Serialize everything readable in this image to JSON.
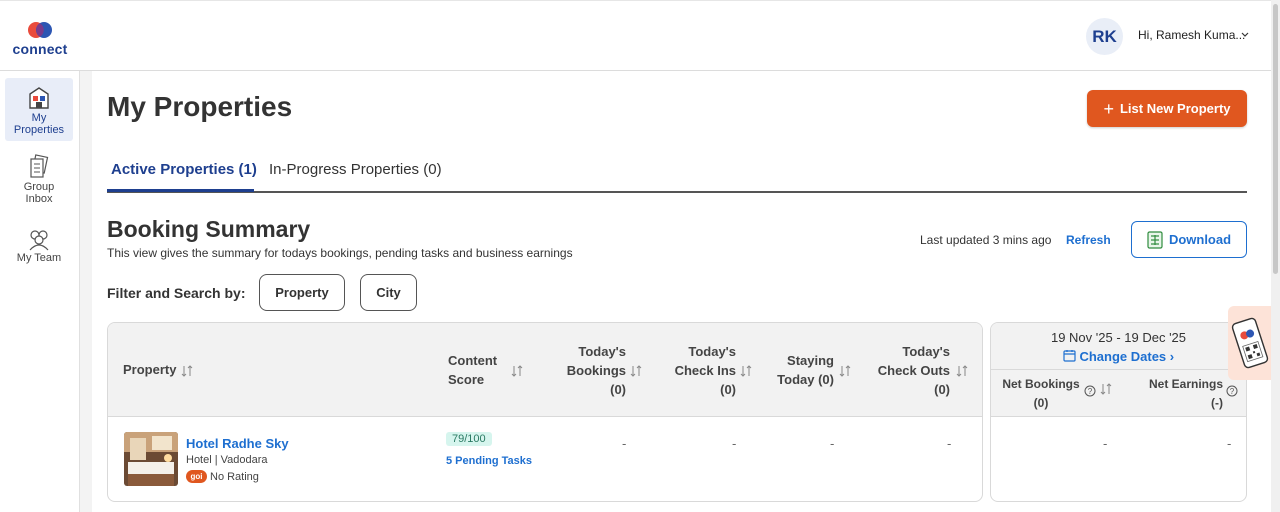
{
  "header": {
    "logo_text": "connect",
    "avatar_initials": "RK",
    "greeting": "Hi, Ramesh Kuma..."
  },
  "sidebar": {
    "items": [
      {
        "label_line1": "My",
        "label_line2": "Properties",
        "icon": "properties-icon",
        "active": true
      },
      {
        "label_line1": "Group",
        "label_line2": "Inbox",
        "icon": "group-inbox-icon",
        "active": false
      },
      {
        "label_line1": "My Team",
        "label_line2": "",
        "icon": "team-icon",
        "active": false
      }
    ]
  },
  "page": {
    "title": "My Properties",
    "primary_button": "List New Property"
  },
  "tabs": [
    {
      "label": "Active Properties (1)",
      "active": true
    },
    {
      "label": "In-Progress Properties (0)",
      "active": false
    }
  ],
  "summary": {
    "title": "Booking Summary",
    "subtitle": "This view gives the summary for todays bookings, pending tasks and business earnings",
    "last_updated": "Last updated 3 mins ago",
    "refresh": "Refresh",
    "download": "Download"
  },
  "filter": {
    "label": "Filter and Search by:",
    "chips": [
      "Property",
      "City"
    ]
  },
  "table": {
    "headers": {
      "property": "Property",
      "content_score_l1": "Content",
      "content_score_l2": "Score",
      "bookings_l1": "Today's",
      "bookings_l2": "Bookings",
      "bookings_l3": "(0)",
      "checkins_l1": "Today's",
      "checkins_l2": "Check Ins",
      "checkins_l3": "(0)",
      "staying_l1": "Staying",
      "staying_l2": "Today (0)",
      "checkouts_l1": "Today's",
      "checkouts_l2": "Check Outs",
      "checkouts_l3": "(0)"
    },
    "rows": [
      {
        "name": "Hotel Radhe Sky",
        "type_city": "Hotel | Vadodara",
        "rating_badge": "goibibo",
        "rating": "No Rating",
        "score": "79/100",
        "pending": "5 Pending Tasks",
        "bookings": "-",
        "checkins": "-",
        "staying": "-",
        "checkouts": "-"
      }
    ]
  },
  "earnings": {
    "date_range": "19 Nov '25 - 19 Dec '25",
    "change_dates": "Change Dates",
    "net_bookings_l1": "Net Bookings",
    "net_bookings_l2": "(0)",
    "net_earnings_l1": "Net Earnings",
    "net_earnings_l2": "(-)",
    "row_bookings": "-",
    "row_earnings": "-"
  },
  "colors": {
    "brand_blue": "#1e3f8f",
    "link_blue": "#1e6fd0",
    "accent_orange": "#e0571f"
  }
}
